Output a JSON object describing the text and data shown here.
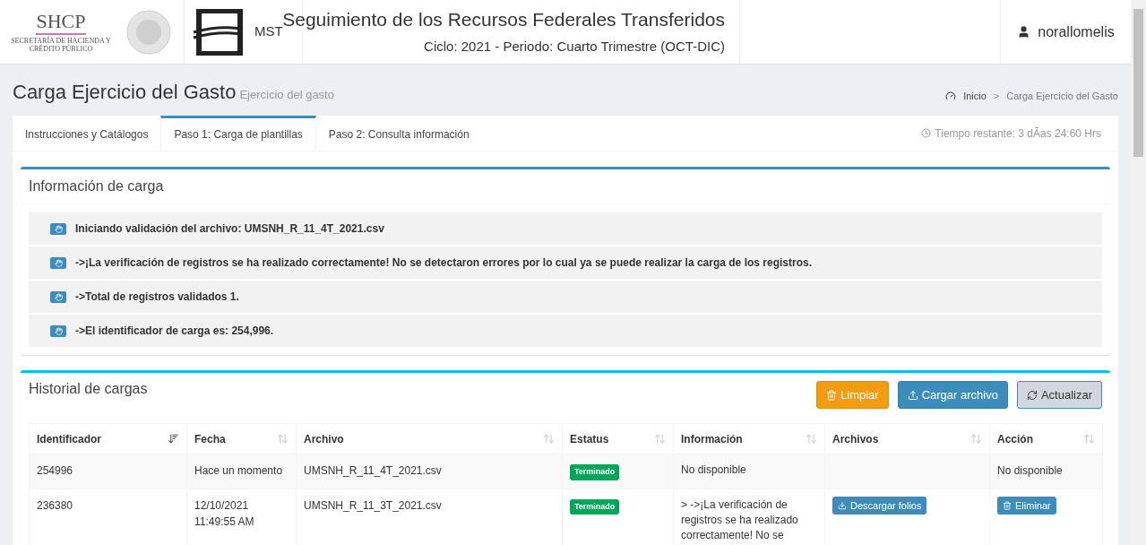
{
  "header": {
    "agency": "SHCP",
    "agency_subtitle": "SECRETARÍA DE HACIENDA Y CRÉDITO PÚBLICO",
    "system_logo": "MST",
    "title": "Seguimiento de los Recursos Federales Transferidos",
    "subtitle": "Ciclo: 2021 - Periodo: Cuarto Trimestre (OCT-DIC)",
    "user": "norallomelis"
  },
  "page": {
    "title": "Carga Ejercicio del Gasto",
    "subtitle": "Ejercicio del gasto"
  },
  "breadcrumb": [
    {
      "label": "Inicio"
    },
    {
      "label": "Carga Ejercicio del Gasto"
    }
  ],
  "breadcrumb_separator": ">",
  "tabs": [
    {
      "label": "Instrucciones y Catálogos",
      "selected": false
    },
    {
      "label": "Paso 1: Carga de plantillas",
      "selected": true
    },
    {
      "label": "Paso 2: Consulta información",
      "selected": false
    }
  ],
  "time_remaining": "Tiempo restante: 3 dÃas 24:60 Hrs",
  "info_panel": {
    "title": "Información de carga",
    "messages": [
      "Iniciando validación del archivo: UMSNH_R_11_4T_2021.csv",
      "->¡La verificación de registros se ha realizado correctamente! No se detectaron errores por lo cual ya se puede realizar la carga de los registros.",
      "->Total de registros validados 1.",
      "->El identificador de carga es: 254,996."
    ]
  },
  "history": {
    "title": "Historial de cargas",
    "buttons": [
      {
        "label": "Limpiar",
        "kind": "warning"
      },
      {
        "label": "Cargar archivo",
        "kind": "primary"
      },
      {
        "label": "Actualizar",
        "kind": "default"
      }
    ],
    "columns": [
      {
        "label": "Identificador",
        "sorted": true
      },
      {
        "label": "Fecha",
        "sorted": false
      },
      {
        "label": "Archivo",
        "sorted": false
      },
      {
        "label": "Estatus",
        "sorted": false
      },
      {
        "label": "Información",
        "sorted": false
      },
      {
        "label": "Archivos",
        "sorted": false
      },
      {
        "label": "Acción",
        "sorted": false
      }
    ],
    "rows": [
      {
        "id": "254996",
        "date": "Hace un momento",
        "file": "UMSNH_R_11_4T_2021.csv",
        "status": "Terminado",
        "info": "No disponible",
        "download": null,
        "action": {
          "kind": "text",
          "label": "No disponible"
        }
      },
      {
        "id": "236380",
        "date": "12/10/2021 11:49:55 AM",
        "file": "UMSNH_R_11_3T_2021.csv",
        "status": "Terminado",
        "info": "> ->¡La verificación de registros se ha realizado correctamente! No se",
        "download": "Descargar folios",
        "action": {
          "kind": "button",
          "label": "Eliminar"
        }
      }
    ]
  }
}
